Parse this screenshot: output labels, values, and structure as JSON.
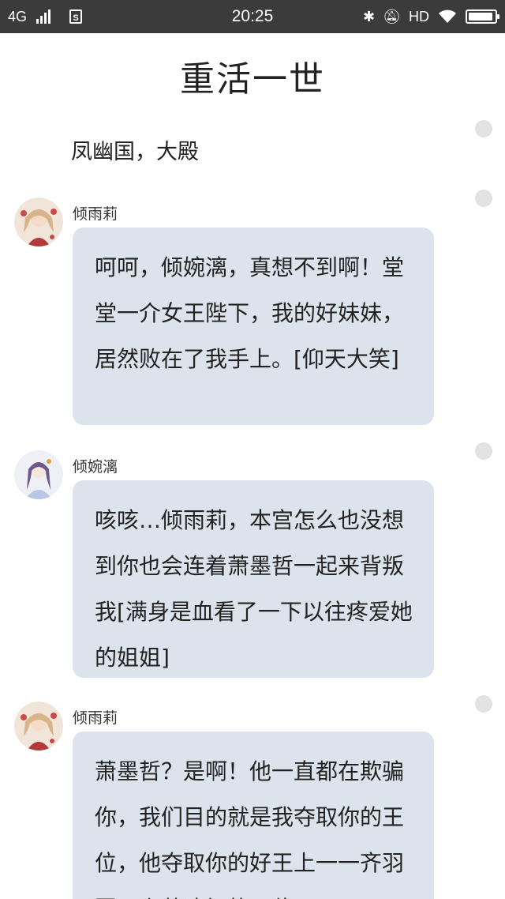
{
  "status_bar": {
    "network": "4G",
    "time": "20:25",
    "hd": "HD",
    "battery_level": 0.95
  },
  "title": "重活一世",
  "scene": "凤幽国，大殿",
  "messages": [
    {
      "speaker": "倾雨莉",
      "text": "呵呵，倾婉漓，真想不到啊！堂堂一介女王陛下，我的好妹妹，居然败在了我手上。[仰天大笑]"
    },
    {
      "speaker": "倾婉漓",
      "text": "咳咳…倾雨莉，本宫怎么也没想到你也会连着萧墨哲一起来背叛我[满身是血看了一下以往疼爱她的姐姐]"
    },
    {
      "speaker": "倾雨莉",
      "text": "萧墨哲？是啊！他一直都在欺骗你，我们目的就是我夺取你的王位，他夺取你的好王上一一齐羽国王上萧凌轩的王位"
    }
  ]
}
